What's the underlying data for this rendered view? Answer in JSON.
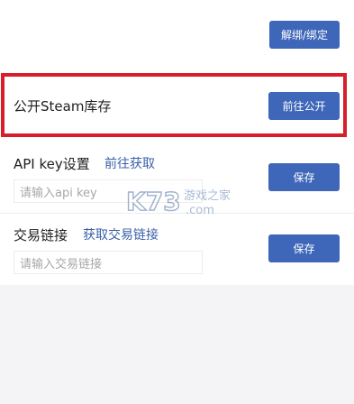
{
  "unbind_button": "解绑/绑定",
  "public_inventory": {
    "label": "公开Steam库存",
    "button": "前往公开"
  },
  "api_key": {
    "label": "API key设置",
    "link": "前往获取",
    "placeholder": "请输入api key",
    "button": "保存"
  },
  "trade_link": {
    "label": "交易链接",
    "link": "获取交易链接",
    "placeholder": "请输入交易链接",
    "button": "保存"
  },
  "watermark": {
    "logo": "K73",
    "site": "游戏之家",
    "domain": ".com"
  },
  "colors": {
    "button": "#3e66b9",
    "link": "#3a60a8",
    "highlight": "#d81e2a",
    "background": "#f4f4f6"
  }
}
